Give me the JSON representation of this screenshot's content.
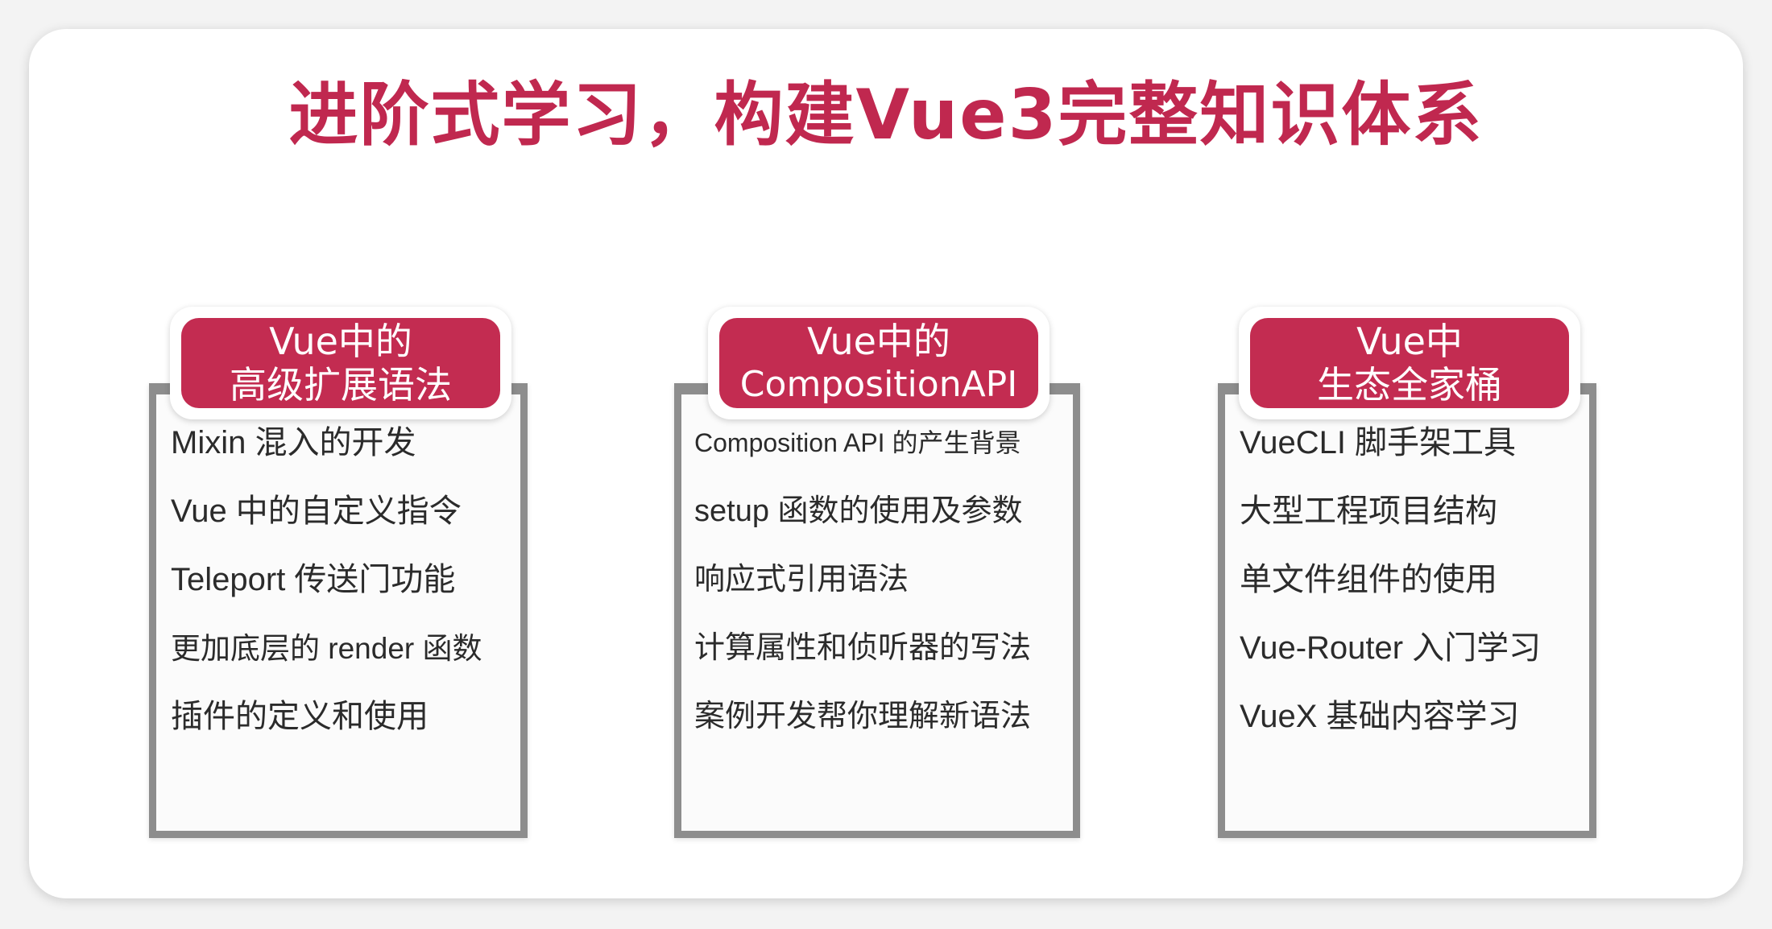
{
  "title": "进阶式学习，构建Vue3完整知识体系",
  "cards": [
    {
      "header_line1": "Vue中的",
      "header_line2": "高级扩展语法",
      "items": [
        "Mixin 混入的开发",
        "Vue 中的自定义指令",
        "Teleport 传送门功能",
        "更加底层的 render 函数",
        "插件的定义和使用"
      ]
    },
    {
      "header_line1": "Vue中的",
      "header_line2": "CompositionAPI",
      "items": [
        "Composition API 的产生背景",
        "setup 函数的使用及参数",
        "响应式引用语法",
        "计算属性和侦听器的写法",
        "案例开发帮你理解新语法"
      ]
    },
    {
      "header_line1": "Vue中",
      "header_line2": "生态全家桶",
      "items": [
        "VueCLI 脚手架工具",
        "大型工程项目结构",
        "单文件组件的使用",
        "Vue-Router 入门学习",
        "VueX 基础内容学习"
      ]
    }
  ],
  "colors": {
    "accent": "#c32c51",
    "title": "#c0284f",
    "frame": "#8d8d8d",
    "text": "#2b2b2b"
  }
}
